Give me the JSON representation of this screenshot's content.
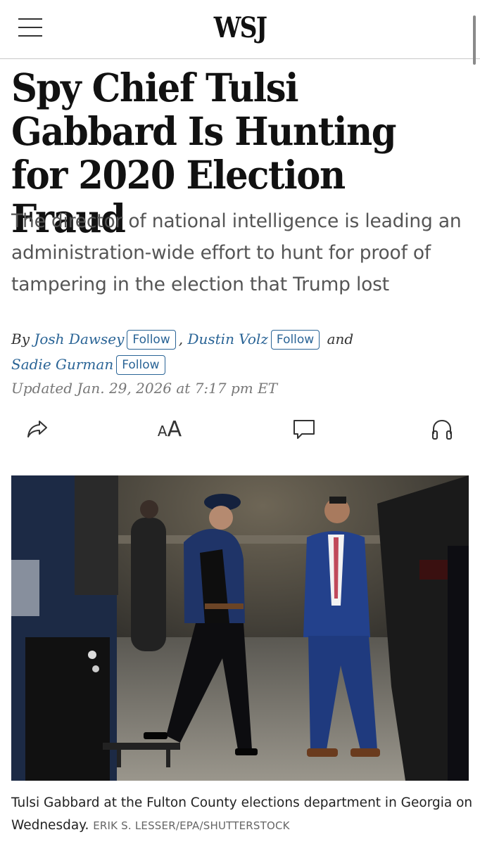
{
  "header": {
    "logo": "WSJ",
    "menu_icon": "hamburger-menu-icon"
  },
  "article": {
    "headline": "Spy Chief Tulsi Gabbard Is Hunting for 2020 Election Fraud",
    "dek": "The director of national intelligence is leading an administration-wide effort to hunt for proof of tampering in the election that Trump lost",
    "byline": {
      "prefix": "By",
      "authors": [
        {
          "name": "Josh Dawsey",
          "follow": "Follow"
        },
        {
          "name": "Dustin Volz",
          "follow": "Follow"
        },
        {
          "name": "Sadie Gurman",
          "follow": "Follow"
        }
      ],
      "separator": ",",
      "conjunction": "and"
    },
    "updated": "Updated Jan. 29, 2026 at 7:17 pm ET",
    "tools": {
      "share_icon": "share-icon",
      "text_size_label": "AA",
      "comments_icon": "comment-icon",
      "listen_icon": "headphones-icon"
    },
    "photo": {
      "caption": "Tulsi Gabbard at the Fulton County elections department in Georgia on Wednesday.",
      "credit": "ERIK S. LESSER/EPA/SHUTTERSTOCK"
    }
  },
  "colors": {
    "link": "#2a6496",
    "dek_text": "#555555",
    "meta_text": "#777777"
  }
}
